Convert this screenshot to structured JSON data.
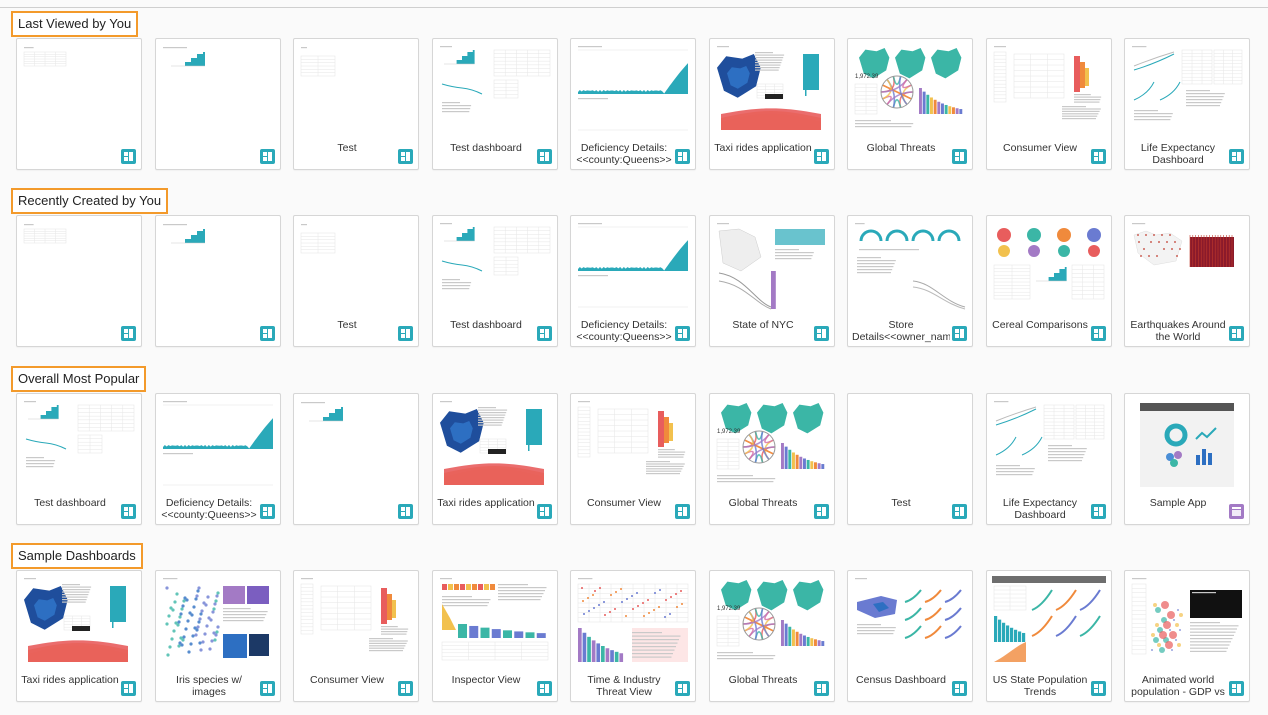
{
  "colors": {
    "accent_orange": "#f39a2b",
    "badge_dashboard": "#2aa9b9",
    "badge_app": "#a37ac5"
  },
  "sections": [
    {
      "title": "Last Viewed by You",
      "items": [
        {
          "title": "",
          "thumb": "table",
          "type": "dashboard"
        },
        {
          "title": "",
          "thumb": "steps",
          "type": "dashboard"
        },
        {
          "title": "Test",
          "thumb": "minitable",
          "type": "dashboard"
        },
        {
          "title": "Test dashboard",
          "thumb": "testdash",
          "type": "dashboard"
        },
        {
          "title": "Deficiency Details: <<county:Queens>>",
          "thumb": "area",
          "type": "dashboard"
        },
        {
          "title": "Taxi rides application",
          "thumb": "taxi",
          "type": "dashboard"
        },
        {
          "title": "Global Threats",
          "thumb": "threats",
          "type": "dashboard"
        },
        {
          "title": "Consumer View",
          "thumb": "consumer",
          "type": "dashboard"
        },
        {
          "title": "Life Expectancy Dashboard",
          "thumb": "life",
          "type": "dashboard"
        }
      ]
    },
    {
      "title": "Recently Created by You",
      "items": [
        {
          "title": "",
          "thumb": "table",
          "type": "dashboard"
        },
        {
          "title": "",
          "thumb": "steps",
          "type": "dashboard"
        },
        {
          "title": "Test",
          "thumb": "minitable",
          "type": "dashboard"
        },
        {
          "title": "Test dashboard",
          "thumb": "testdash",
          "type": "dashboard"
        },
        {
          "title": "Deficiency Details: <<county:Queens>>",
          "thumb": "area",
          "type": "dashboard"
        },
        {
          "title": "State of NYC",
          "thumb": "nyc",
          "type": "dashboard"
        },
        {
          "title": "Store Details<<owner_name:",
          "thumb": "store",
          "type": "dashboard"
        },
        {
          "title": "Cereal Comparisons",
          "thumb": "cereal",
          "type": "dashboard"
        },
        {
          "title": "Earthquakes Around the World",
          "thumb": "quake",
          "type": "dashboard"
        }
      ]
    },
    {
      "title": "Overall Most Popular",
      "items": [
        {
          "title": "Test dashboard",
          "thumb": "testdash",
          "type": "dashboard"
        },
        {
          "title": "Deficiency Details: <<county:Queens>>",
          "thumb": "area",
          "type": "dashboard"
        },
        {
          "title": "",
          "thumb": "steps",
          "type": "dashboard"
        },
        {
          "title": "Taxi rides application",
          "thumb": "taxi",
          "type": "dashboard"
        },
        {
          "title": "Consumer View",
          "thumb": "consumer",
          "type": "dashboard"
        },
        {
          "title": "Global Threats",
          "thumb": "threats",
          "type": "dashboard"
        },
        {
          "title": "Test",
          "thumb": "blank",
          "type": "dashboard"
        },
        {
          "title": "Life Expectancy Dashboard",
          "thumb": "life",
          "type": "dashboard"
        },
        {
          "title": "Sample App",
          "thumb": "sampleapp",
          "type": "app"
        }
      ]
    },
    {
      "title": "Sample Dashboards",
      "items": [
        {
          "title": "Taxi rides application",
          "thumb": "taxi",
          "type": "dashboard"
        },
        {
          "title": "Iris species w/ images",
          "thumb": "iris",
          "type": "dashboard"
        },
        {
          "title": "Consumer View",
          "thumb": "consumer",
          "type": "dashboard"
        },
        {
          "title": "Inspector View",
          "thumb": "inspector",
          "type": "dashboard"
        },
        {
          "title": "Time & Industry Threat View",
          "thumb": "timeind",
          "type": "dashboard"
        },
        {
          "title": "Global Threats",
          "thumb": "threats",
          "type": "dashboard"
        },
        {
          "title": "Census Dashboard",
          "thumb": "census",
          "type": "dashboard"
        },
        {
          "title": "US State Population Trends",
          "thumb": "uspop",
          "type": "dashboard"
        },
        {
          "title": "Animated world population - GDP vs life",
          "thumb": "animated",
          "type": "dashboard"
        }
      ]
    }
  ]
}
